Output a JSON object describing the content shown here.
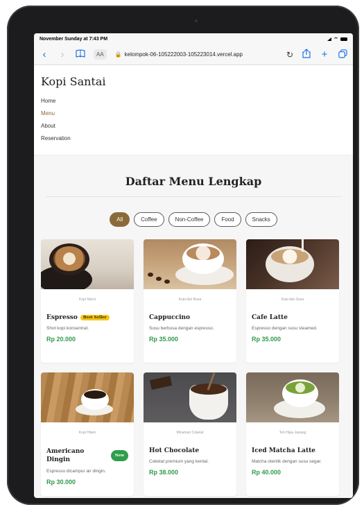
{
  "status": {
    "time": "November Sunday at 7:43 PM"
  },
  "browser": {
    "url": "kelompok-06-105222003-105223014.vercel.app",
    "aa_label": "AA",
    "back_icon": "chevron-left-icon",
    "forward_icon": "chevron-right-icon",
    "bookmarks_icon": "book-icon",
    "share_icon": "share-icon",
    "new_tab_icon": "plus-icon",
    "tabs_icon": "tabs-icon"
  },
  "site": {
    "brand": "Kopi Santai",
    "nav": [
      {
        "label": "Home",
        "active": false
      },
      {
        "label": "Menu",
        "active": true
      },
      {
        "label": "About",
        "active": false
      },
      {
        "label": "Reservation",
        "active": false
      }
    ]
  },
  "menu": {
    "title": "Daftar Menu Lengkap",
    "filters": [
      {
        "label": "All",
        "active": true
      },
      {
        "label": "Coffee",
        "active": false
      },
      {
        "label": "Non-Coffee",
        "active": false
      },
      {
        "label": "Food",
        "active": false
      },
      {
        "label": "Snacks",
        "active": false
      }
    ],
    "items": [
      {
        "category": "Kopi Murni",
        "name": "Espresso",
        "badge": "Best Seller",
        "description": "Shot kopi konsentrat.",
        "price": "Rp 20.000"
      },
      {
        "category": "Kopi dan Busa",
        "name": "Cappuccino",
        "badge": "",
        "description": "Susu berbusa dengan espresso.",
        "price": "Rp 35.000"
      },
      {
        "category": "Kopi dan Susu",
        "name": "Cafe Latte",
        "badge": "",
        "description": "Espresso dengan susu steamed.",
        "price": "Rp 35.000"
      },
      {
        "category": "Kopi Hitam",
        "name": "Americano Dingin",
        "badge": "New",
        "description": "Espresso dicampur air dingin.",
        "price": "Rp 30.000"
      },
      {
        "category": "Minuman Cokelat",
        "name": "Hot Chocolate",
        "badge": "",
        "description": "Cokelat premium yang kental.",
        "price": "Rp 38.000"
      },
      {
        "category": "Teh Hijau Jepang",
        "name": "Iced Matcha Latte",
        "badge": "",
        "description": "Matcha otentik dengan susu segar.",
        "price": "Rp 40.000"
      }
    ]
  },
  "colors": {
    "accent": "#8b6a3a",
    "price": "#2e9a4a",
    "best_seller": "#f5c518",
    "new": "#2e9e4d",
    "link": "#1a73e8"
  }
}
